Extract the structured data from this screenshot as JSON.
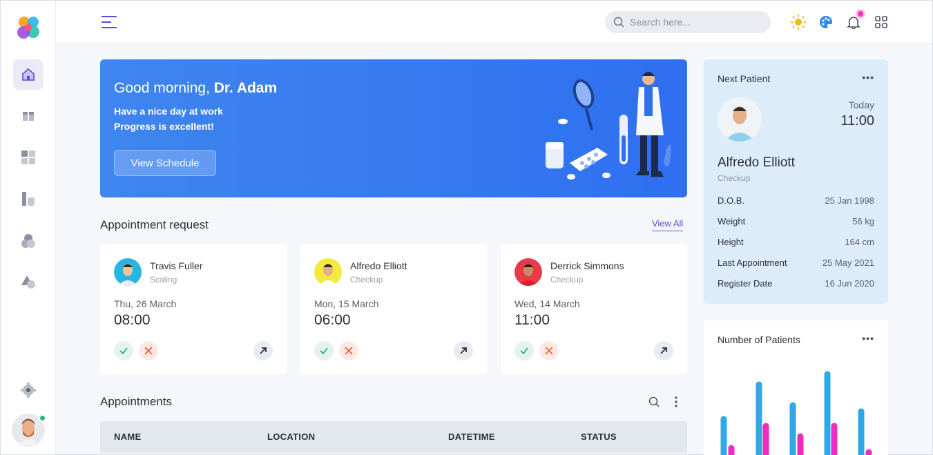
{
  "topbar": {
    "search_placeholder": "Search here..."
  },
  "banner": {
    "greeting": "Good morning, ",
    "doctor": "Dr. Adam",
    "line1": "Have a nice day at work",
    "line2_prefix": "Progress is ",
    "line2_status": "excellent!",
    "button": "View Schedule"
  },
  "requests": {
    "title": "Appointment request",
    "view_all": "View All",
    "items": [
      {
        "name": "Travis Fuller",
        "type": "Scaling",
        "date": "Thu, 26 March",
        "time": "08:00"
      },
      {
        "name": "Alfredo Elliott",
        "type": "Checkup",
        "date": "Mon, 15 March",
        "time": "06:00"
      },
      {
        "name": "Derrick Simmons",
        "type": "Checkup",
        "date": "Wed, 14 March",
        "time": "11:00"
      }
    ]
  },
  "appointments": {
    "title": "Appointments",
    "columns": [
      "NAME",
      "LOCATION",
      "DATETIME",
      "STATUS"
    ]
  },
  "next_patient": {
    "title": "Next Patient",
    "day": "Today",
    "time": "11:00",
    "name": "Alfredo Elliott",
    "type": "Checkup",
    "details": [
      {
        "label": "D.O.B.",
        "value": "25 Jan 1998"
      },
      {
        "label": "Weight",
        "value": "56 kg"
      },
      {
        "label": "Height",
        "value": "164 cm"
      },
      {
        "label": "Last Appointment",
        "value": "25 May 2021"
      },
      {
        "label": "Register Date",
        "value": "16 Jun 2020"
      }
    ]
  },
  "patients_chart": {
    "title": "Number of Patients",
    "colors": {
      "series_a": "#2fa8e8",
      "series_b": "#f02cc0"
    }
  },
  "menu_dots": "•••"
}
